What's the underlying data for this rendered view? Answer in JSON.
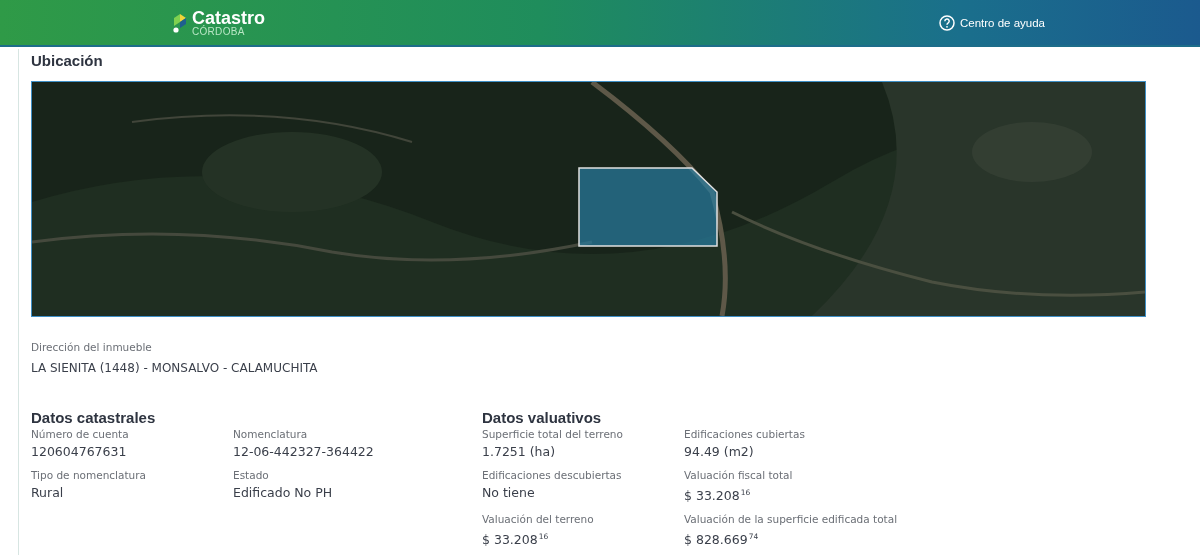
{
  "header": {
    "brand": "Catastro",
    "brand_sub": "CÓRDOBA",
    "help_link": "Centro de ayuda"
  },
  "location": {
    "title": "Ubicación",
    "address_label": "Dirección del inmueble",
    "address": "LA SIENITA (1448) - MONSALVO - CALAMUCHITA"
  },
  "sections": [
    {
      "title": "Datos catastrales",
      "fields": [
        {
          "label": "Número de cuenta",
          "value": "120604767631"
        },
        {
          "label": "Nomenclatura",
          "value": "12-06-442327-364422"
        },
        {
          "label": "Tipo de nomenclatura",
          "value": "Rural"
        },
        {
          "label": "Estado",
          "value": "Edificado No PH"
        }
      ]
    },
    {
      "title": "Datos valuativos",
      "fields": [
        {
          "label": "Superficie total del terreno",
          "value": "1.7251 (ha)"
        },
        {
          "label": "Edificaciones cubiertas",
          "value": "94.49 (m2)"
        },
        {
          "label": "Edificaciones descubiertas",
          "value": "No tiene"
        },
        {
          "label": "Valuación fiscal total",
          "value": "$ 33.208$^{16}$"
        },
        {
          "label": "Valuación del terreno",
          "value": "$ 33.208$^{16}$"
        },
        {
          "label": "Valuación de la superficie edificada total",
          "value": "$ 828.669$^{74}$"
        }
      ]
    }
  ]
}
